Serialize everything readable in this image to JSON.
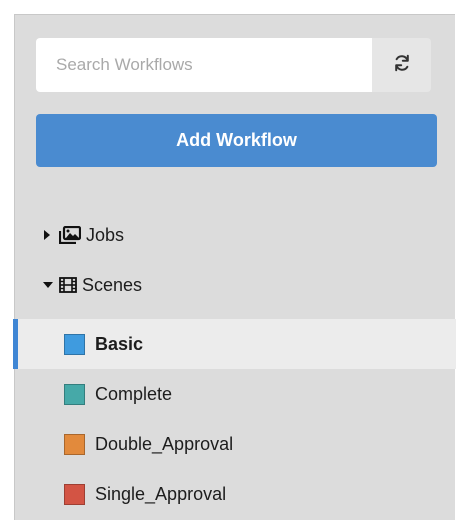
{
  "search": {
    "placeholder": "Search Workflows",
    "value": ""
  },
  "refresh": {
    "icon": "refresh-icon"
  },
  "add_workflow": {
    "label": "Add Workflow"
  },
  "tree": {
    "jobs": {
      "label": "Jobs",
      "expanded": false,
      "icon": "images-icon"
    },
    "scenes": {
      "label": "Scenes",
      "expanded": true,
      "icon": "film-icon"
    }
  },
  "workflows": [
    {
      "label": "Basic",
      "color": "#3f9bdf",
      "selected": true
    },
    {
      "label": "Complete",
      "color": "#46a9a8",
      "selected": false
    },
    {
      "label": "Double_Approval",
      "color": "#e28a3c",
      "selected": false
    },
    {
      "label": "Single_Approval",
      "color": "#d35444",
      "selected": false
    }
  ],
  "colors": {
    "accent": "#4a8bd0",
    "selection": "#3f86d4",
    "panel": "#dcdcdc"
  }
}
